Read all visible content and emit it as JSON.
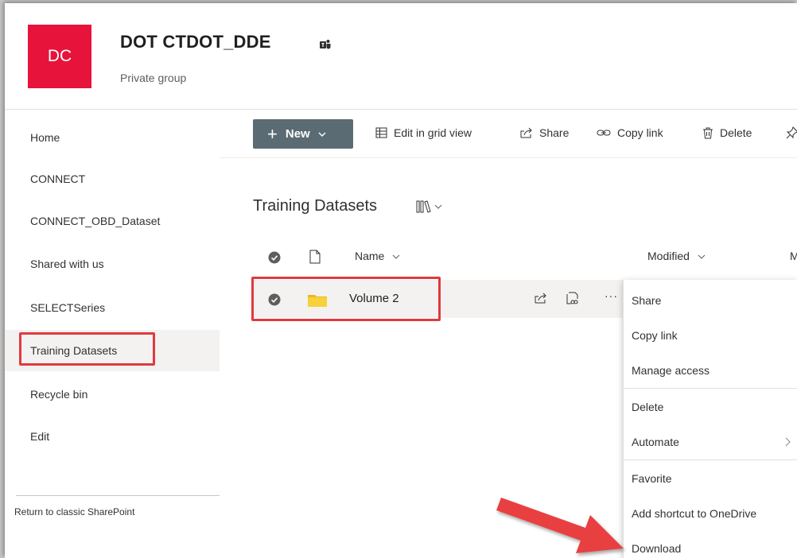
{
  "header": {
    "logo_initials": "DC",
    "site_title": "DOT CTDOT_DDE",
    "site_subtitle": "Private group"
  },
  "leftnav": {
    "items": [
      {
        "label": "Home"
      },
      {
        "label": "CONNECT"
      },
      {
        "label": "CONNECT_OBD_Dataset"
      },
      {
        "label": "Shared with us"
      },
      {
        "label": "SELECTSeries"
      },
      {
        "label": "Training Datasets",
        "selected": true
      },
      {
        "label": "Recycle bin"
      },
      {
        "label": "Edit"
      }
    ],
    "classic_link": "Return to classic SharePoint"
  },
  "commandbar": {
    "new_label": "New",
    "edit_grid_label": "Edit in grid view",
    "share_label": "Share",
    "copy_link_label": "Copy link",
    "delete_label": "Delete"
  },
  "library": {
    "title": "Training Datasets",
    "columns": {
      "name": "Name",
      "modified": "Modified",
      "modified_by_partial": "M"
    },
    "rows": [
      {
        "name": "Volume 2",
        "type": "folder",
        "selected": true
      }
    ]
  },
  "context_menu": {
    "items": [
      {
        "label": "Share"
      },
      {
        "label": "Copy link"
      },
      {
        "label": "Manage access"
      },
      {
        "label": "Delete"
      },
      {
        "label": "Automate",
        "has_submenu": true
      },
      {
        "label": "Favorite"
      },
      {
        "label": "Add shortcut to OneDrive"
      },
      {
        "label": "Download"
      }
    ]
  },
  "colors": {
    "logo_bg": "#e8133b",
    "new_button_bg": "#5b6b73",
    "annotation_red": "#e03a3e",
    "folder_yellow": "#f8d038",
    "selected_bg": "#f3f2f1"
  },
  "icons": {
    "teams": "teams-icon",
    "plus": "plus-icon",
    "grid": "grid-icon",
    "share": "share-icon",
    "link": "link-icon",
    "trash": "trash-icon",
    "pin": "pin-icon",
    "library_view": "library-view-icon",
    "check": "check-circle-icon",
    "document": "document-icon",
    "folder": "folder-icon",
    "more": "more-icon",
    "arrow": "annotation-arrow"
  }
}
